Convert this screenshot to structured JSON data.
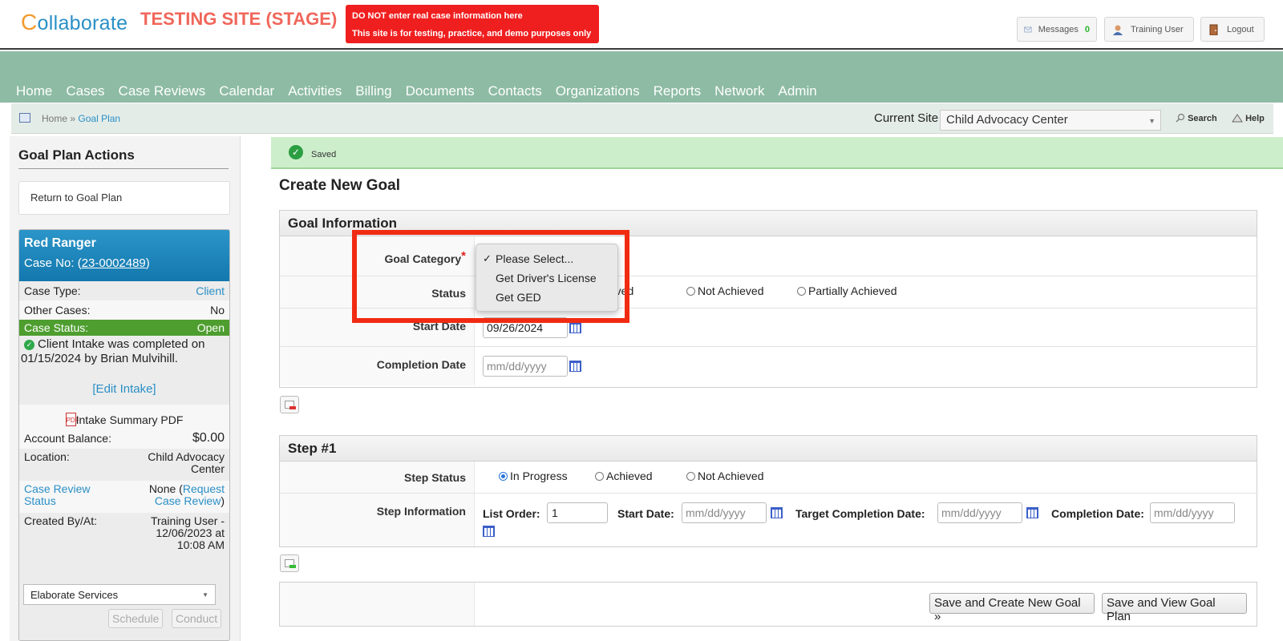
{
  "header": {
    "logo_first": "C",
    "logo_rest": "ollaborate",
    "site_label": "TESTING SITE (STAGE)",
    "warning_line1": "DO NOT enter real case information here",
    "warning_line2": "This site is for testing, practice, and demo purposes only",
    "messages_label": "Messages",
    "messages_count": "0",
    "user_label": "Training User",
    "logout_label": "Logout"
  },
  "nav": [
    "Home",
    "Cases",
    "Case Reviews",
    "Calendar",
    "Activities",
    "Billing",
    "Documents",
    "Contacts",
    "Organizations",
    "Reports",
    "Network",
    "Admin"
  ],
  "breadcrumb": {
    "home": "Home",
    "sep": "»",
    "current": "Goal Plan"
  },
  "site": {
    "label": "Current Site",
    "value": "Child Advocacy Center",
    "search": "Search",
    "help": "Help"
  },
  "sidebar": {
    "title": "Goal Plan Actions",
    "return_label": "Return to Goal Plan",
    "client_name": "Red Ranger",
    "case_no_prefix": "Case No: (",
    "case_no": "23-0002489",
    "case_no_suffix": ")",
    "case_type_label": "Case Type:",
    "case_type_value": "Client",
    "other_cases_label": "Other Cases:",
    "other_cases_value": "No",
    "case_status_label": "Case Status:",
    "case_status_value": "Open",
    "intake_text": "Client Intake was completed on 01/15/2024 by Brian Mulvihill.",
    "edit_intake": "[Edit Intake]",
    "pdf_label": "Intake Summary PDF",
    "balance_label": "Account Balance:",
    "balance_value": "$0.00",
    "location_label": "Location:",
    "location_value": "Child Advocacy Center",
    "review_label": "Case Review Status",
    "review_none": "None (",
    "review_link": "Request Case Review",
    "review_close": ")",
    "created_label": "Created By/At:",
    "created_value": "Training User - 12/06/2023 at 10:08 AM",
    "services_value": "Elaborate Services",
    "schedule_label": "Schedule",
    "conduct_label": "Conduct"
  },
  "notice": {
    "text": "Saved"
  },
  "page_title": "Create New Goal",
  "goal_info": {
    "title": "Goal Information",
    "category_label": "Goal Category",
    "required_mark": "*",
    "category_options": [
      "Please Select...",
      "Get Driver's License",
      "Get GED"
    ],
    "category_selected": "Please Select...",
    "status_label": "Status",
    "status_options": [
      "Achieved",
      "Not Achieved",
      "Partially Achieved"
    ],
    "status_hidden_partial": "chieved",
    "start_label": "Start Date",
    "start_value": "09/26/2024",
    "completion_label": "Completion Date",
    "date_placeholder": "mm/dd/yyyy"
  },
  "step": {
    "title": "Step #1",
    "status_label": "Step Status",
    "status_options": [
      "In Progress",
      "Achieved",
      "Not Achieved"
    ],
    "status_selected": "In Progress",
    "info_label": "Step Information",
    "list_order_label": "List Order:",
    "list_order_value": "1",
    "start_label": "Start Date:",
    "target_label": "Target Completion Date:",
    "completion_label": "Completion Date:",
    "date_placeholder": "mm/dd/yyyy"
  },
  "actions": {
    "save_new": "Save and Create New Goal »",
    "save_view": "Save and View Goal Plan"
  }
}
